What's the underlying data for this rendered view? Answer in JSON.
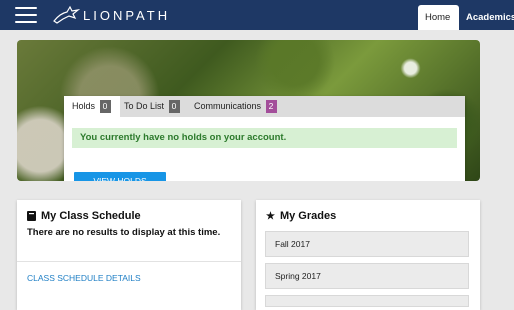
{
  "header": {
    "logo_text": "LIONPATH",
    "tabs": [
      {
        "label": "Home"
      },
      {
        "label": "Academics"
      }
    ]
  },
  "holds_card": {
    "tabs": [
      {
        "label": "Holds",
        "count": "0"
      },
      {
        "label": "To Do List",
        "count": "0"
      },
      {
        "label": "Communications",
        "count": "2"
      }
    ],
    "message": "You currently have no holds on your account.",
    "button_label": "VIEW HOLDS"
  },
  "schedule": {
    "title": "My Class Schedule",
    "message": "There are no results to display at this time.",
    "link_label": "CLASS SCHEDULE DETAILS"
  },
  "grades": {
    "title": "My Grades",
    "terms": [
      {
        "label": "Fall 2017"
      },
      {
        "label": "Spring 2017"
      },
      {
        "label": ""
      }
    ]
  },
  "colors": {
    "header_bg": "#1e3865",
    "accent_blue": "#1795e6",
    "success_bg": "#d7f0d3",
    "success_text": "#2c7a2c",
    "communications_badge": "#a34e9a"
  },
  "icons": [
    "hamburger-menu-icon",
    "lion-logo-icon",
    "schedule-icon",
    "star-icon"
  ]
}
